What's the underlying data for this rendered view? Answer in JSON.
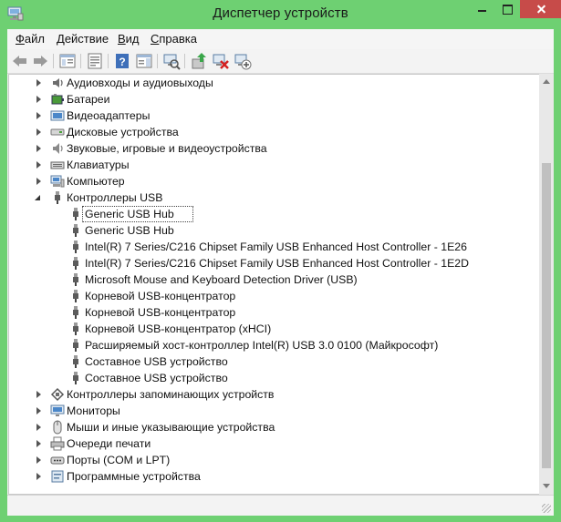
{
  "window": {
    "title": "Диспетчер устройств"
  },
  "menu": [
    {
      "label": "Файл",
      "accel": "Ф",
      "rest": "айл"
    },
    {
      "label": "Действие",
      "accel": "Д",
      "rest": "ействие"
    },
    {
      "label": "Вид",
      "accel": "В",
      "rest": "ид"
    },
    {
      "label": "Справка",
      "accel": "С",
      "rest": "правка"
    }
  ],
  "toolbar": [
    "back-icon",
    "forward-icon",
    "show-hide-tree-icon",
    "properties-icon",
    "help-icon",
    "action-pane-icon",
    "scan-hardware-icon",
    "update-driver-icon",
    "uninstall-device-icon",
    "add-legacy-icon"
  ],
  "tree": {
    "selected_index": 7,
    "rows": [
      {
        "label": "Аудиовходы и аудиовыходы",
        "level": 0,
        "state": "closed",
        "icon": "audio-io-icon"
      },
      {
        "label": "Батареи",
        "level": 0,
        "state": "closed",
        "icon": "battery-icon"
      },
      {
        "label": "Видеоадаптеры",
        "level": 0,
        "state": "closed",
        "icon": "display-adapter-icon"
      },
      {
        "label": "Дисковые устройства",
        "level": 0,
        "state": "closed",
        "icon": "disk-drive-icon"
      },
      {
        "label": "Звуковые, игровые и видеоустройства",
        "level": 0,
        "state": "closed",
        "icon": "speaker-icon"
      },
      {
        "label": "Клавиатуры",
        "level": 0,
        "state": "closed",
        "icon": "keyboard-icon"
      },
      {
        "label": "Компьютер",
        "level": 0,
        "state": "closed",
        "icon": "computer-icon"
      },
      {
        "label": "Контроллеры USB",
        "level": 0,
        "state": "open",
        "icon": "usb-icon"
      },
      {
        "label": "Generic USB Hub",
        "level": 1,
        "state": "none",
        "icon": "usb-icon",
        "selected": true
      },
      {
        "label": "Generic USB Hub",
        "level": 1,
        "state": "none",
        "icon": "usb-icon"
      },
      {
        "label": "Intel(R) 7 Series/C216 Chipset Family USB Enhanced Host Controller - 1E26",
        "level": 1,
        "state": "none",
        "icon": "usb-icon"
      },
      {
        "label": "Intel(R) 7 Series/C216 Chipset Family USB Enhanced Host Controller - 1E2D",
        "level": 1,
        "state": "none",
        "icon": "usb-icon"
      },
      {
        "label": "Microsoft Mouse and Keyboard Detection Driver (USB)",
        "level": 1,
        "state": "none",
        "icon": "usb-icon"
      },
      {
        "label": "Корневой USB-концентратор",
        "level": 1,
        "state": "none",
        "icon": "usb-icon"
      },
      {
        "label": "Корневой USB-концентратор",
        "level": 1,
        "state": "none",
        "icon": "usb-icon"
      },
      {
        "label": "Корневой USB-концентратор (xHCI)",
        "level": 1,
        "state": "none",
        "icon": "usb-icon"
      },
      {
        "label": "Расширяемый хост-контроллер Intel(R) USB 3.0 0100 (Майкрософт)",
        "level": 1,
        "state": "none",
        "icon": "usb-icon"
      },
      {
        "label": "Составное USB устройство",
        "level": 1,
        "state": "none",
        "icon": "usb-icon"
      },
      {
        "label": "Составное USB устройство",
        "level": 1,
        "state": "none",
        "icon": "usb-icon"
      },
      {
        "label": "Контроллеры запоминающих устройств",
        "level": 0,
        "state": "closed",
        "icon": "storage-controller-icon"
      },
      {
        "label": "Мониторы",
        "level": 0,
        "state": "closed",
        "icon": "monitor-icon"
      },
      {
        "label": "Мыши и иные указывающие устройства",
        "level": 0,
        "state": "closed",
        "icon": "mouse-icon"
      },
      {
        "label": "Очереди печати",
        "level": 0,
        "state": "closed",
        "icon": "print-queue-icon"
      },
      {
        "label": "Порты (COM и LPT)",
        "level": 0,
        "state": "closed",
        "icon": "port-icon"
      },
      {
        "label": "Программные устройства",
        "level": 0,
        "state": "closed",
        "icon": "software-device-icon"
      }
    ]
  },
  "colors": {
    "frame": "#6ed072",
    "close": "#c74b49",
    "selection_border": "#444444"
  }
}
